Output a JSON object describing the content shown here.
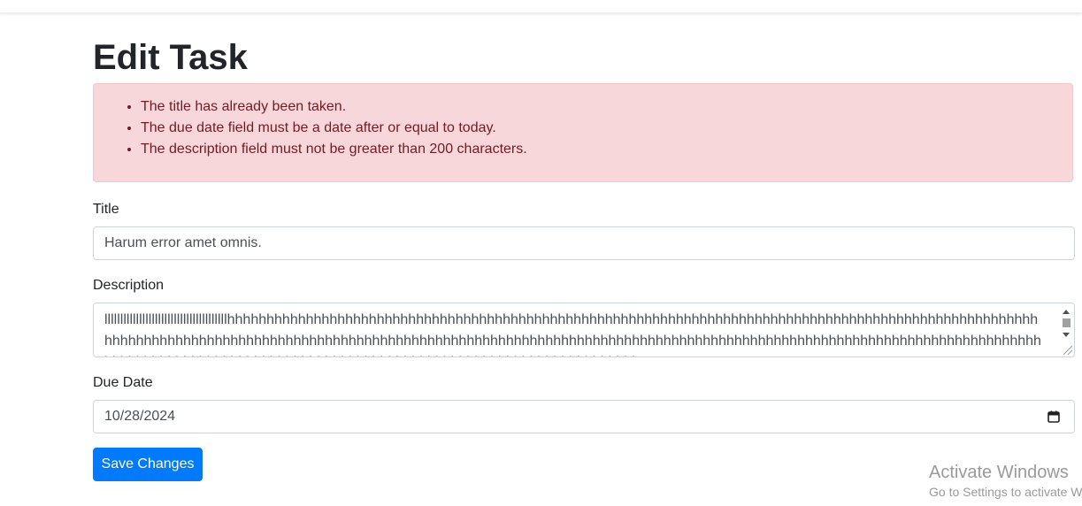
{
  "page": {
    "heading": "Edit Task"
  },
  "errors": [
    "The title has already been taken.",
    "The due date field must be a date after or equal to today.",
    "The description field must not be greater than 200 characters."
  ],
  "form": {
    "title_label": "Title",
    "title_value": "Harum error amet omnis.",
    "description_label": "Description",
    "description_value": "lllllllllllllllllllllllllllllllllllllllhhhhhhhhhhhhhhhhhhhhhhhhhhhhhhhhhhhhhhhhhhhhhhhhhhhhhhhhhhhhhhhhhhhhhhhhhhhhhhhhhhhhhhhhhhhhhhhhhhhhhhhhhhhhhhhhhhhhhhhhhhhhhhhhhhhhhhhhhhhhhhhhhhhhhhhhhhhhhhhhhhhhhhhhhhhhhhhhhhhhhhhhhhhhhhhhhhhhhhhhhhhhhhhhhhhhhhhhhhhhhhhhhhhhhhhhhhhhhhhhhhhhhhhhhhhhhhhhhhhhhhhhhhhhhhhhhhhhhhhhhhhhhhhhhh",
    "due_date_label": "Due Date",
    "due_date_value": "10/28/2024",
    "submit_label": "Save Changes"
  },
  "watermark": {
    "title": "Activate Windows",
    "subtitle": "Go to Settings to activate Windows."
  },
  "colors": {
    "primary": "#007bff",
    "alert_bg": "#f8d7da",
    "alert_text": "#721c24"
  },
  "icons": {
    "date_picker": "calendar-icon"
  }
}
